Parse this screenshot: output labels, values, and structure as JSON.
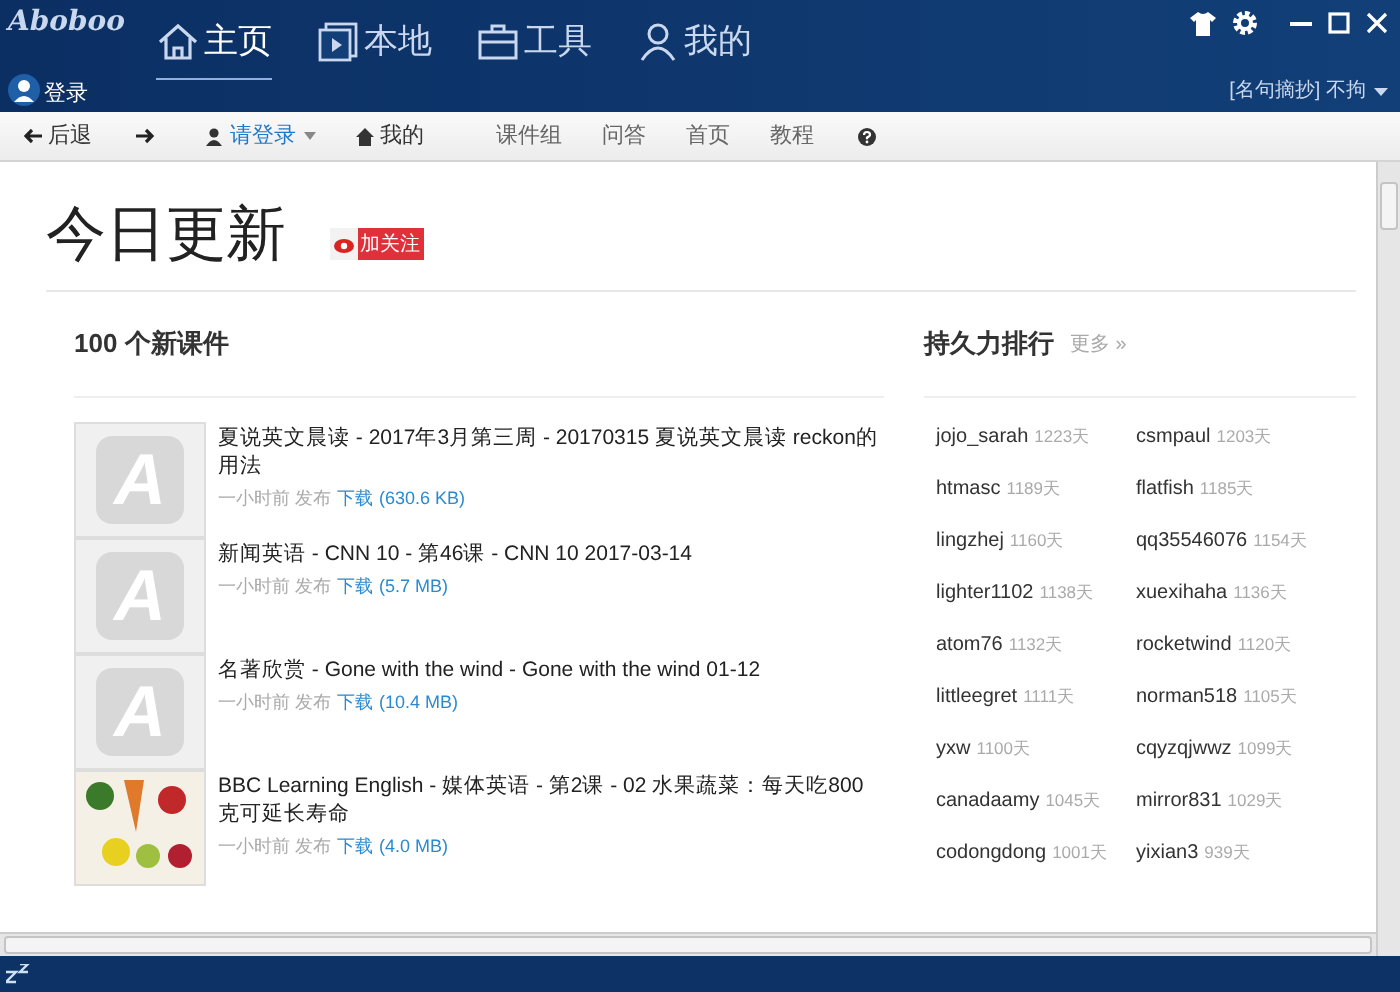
{
  "window": {
    "logo": "Aboboo"
  },
  "nav_tabs": [
    {
      "label": "主页",
      "kind": "home",
      "selected": true
    },
    {
      "label": "本地",
      "kind": "media",
      "selected": false
    },
    {
      "label": "工具",
      "kind": "briefcase",
      "selected": false
    },
    {
      "label": "我的",
      "kind": "user",
      "selected": false
    }
  ],
  "account": {
    "label": "登录"
  },
  "quote": {
    "label": "[名句摘抄] 不拘"
  },
  "toolbar": [
    {
      "kind": "back",
      "label": "后退"
    },
    {
      "kind": "forward"
    },
    {
      "kind": "login",
      "label": "请登录"
    },
    {
      "kind": "home",
      "label": "我的"
    },
    {
      "kind": "link",
      "label": "课件组"
    },
    {
      "kind": "link",
      "label": "问答"
    },
    {
      "kind": "link",
      "label": "首页"
    },
    {
      "kind": "link",
      "label": "教程"
    },
    {
      "kind": "help"
    }
  ],
  "page": {
    "title": "今日更新",
    "follow_button": "加关注"
  },
  "courses": {
    "heading": "100 个新课件",
    "items": [
      {
        "kind": "letter",
        "letter": "A",
        "title": "夏说英文晨读 - 2017年3月第三周 - 20170315 夏说英文晨读 reckon的用法",
        "time": "一小时前 发布",
        "download": "下载",
        "size": "(630.6 KB)"
      },
      {
        "kind": "letter",
        "letter": "A",
        "title": "新闻英语 - CNN 10 - 第46课 - CNN 10 2017-03-14",
        "time": "一小时前 发布",
        "download": "下载",
        "size": "(5.7 MB)"
      },
      {
        "kind": "letter",
        "letter": "A",
        "title": "名著欣赏 - Gone with the wind - Gone with the wind 01-12",
        "time": "一小时前 发布",
        "download": "下载",
        "size": "(10.4 MB)"
      },
      {
        "kind": "photo",
        "title": "BBC Learning English - 媒体英语 - 第2课 - 02 水果蔬菜：每天吃800克可延长寿命",
        "time": "一小时前 发布",
        "download": "下载",
        "size": "(4.0 MB)"
      }
    ]
  },
  "ranking": {
    "heading": "持久力排行",
    "more": "更多 »",
    "items": [
      {
        "user": "jojo_sarah",
        "days": "1223天"
      },
      {
        "user": "csmpaul",
        "days": "1203天"
      },
      {
        "user": "htmasc",
        "days": "1189天"
      },
      {
        "user": "flatfish",
        "days": "1185天"
      },
      {
        "user": "lingzhej",
        "days": "1160天"
      },
      {
        "user": "qq35546076",
        "days": "1154天"
      },
      {
        "user": "lighter1102",
        "days": "1138天"
      },
      {
        "user": "xuexihaha",
        "days": "1136天"
      },
      {
        "user": "atom76",
        "days": "1132天"
      },
      {
        "user": "rocketwind",
        "days": "1120天"
      },
      {
        "user": "littleegret",
        "days": "1111天"
      },
      {
        "user": "norman518",
        "days": "1105天"
      },
      {
        "user": "yxw",
        "days": "1100天"
      },
      {
        "user": "cqyzqjwwz",
        "days": "1099天"
      },
      {
        "user": "canadaamy",
        "days": "1045天"
      },
      {
        "user": "mirror831",
        "days": "1029天"
      },
      {
        "user": "codongdong",
        "days": "1001天"
      },
      {
        "user": "yixian3",
        "days": "939天"
      }
    ]
  }
}
